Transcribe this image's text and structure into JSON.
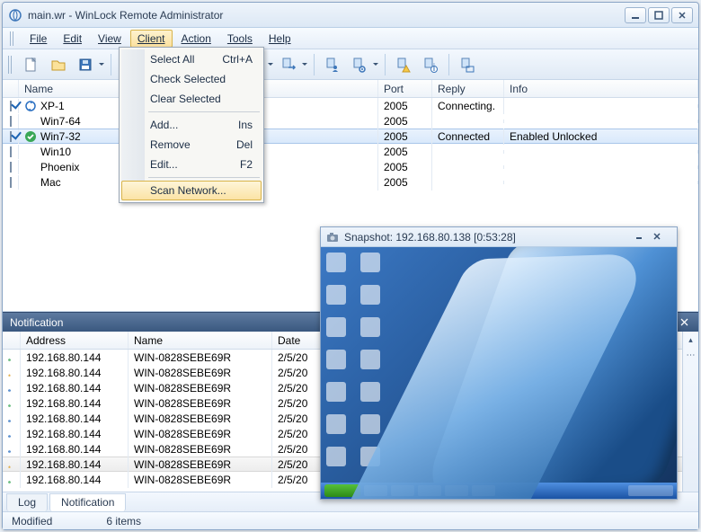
{
  "window": {
    "title": "main.wr - WinLock Remote Administrator"
  },
  "menu": [
    "File",
    "Edit",
    "View",
    "Client",
    "Action",
    "Tools",
    "Help"
  ],
  "client_menu": {
    "select_all": "Select All",
    "select_all_sc": "Ctrl+A",
    "check_selected": "Check Selected",
    "clear_selected": "Clear Selected",
    "add": "Add...",
    "add_sc": "Ins",
    "remove": "Remove",
    "remove_sc": "Del",
    "edit": "Edit...",
    "edit_sc": "F2",
    "scan": "Scan Network..."
  },
  "grid": {
    "cols": {
      "name": "Name",
      "port": "Port",
      "reply": "Reply",
      "info": "Info"
    },
    "rows": [
      {
        "checked": true,
        "status": "sync",
        "name": "XP-1",
        "port": "2005",
        "reply": "Connecting.",
        "info": "",
        "sel": false
      },
      {
        "checked": false,
        "status": "",
        "name": "Win7-64",
        "port": "2005",
        "reply": "",
        "info": "",
        "sel": false
      },
      {
        "checked": true,
        "status": "ok",
        "name": "Win7-32",
        "port": "2005",
        "reply": "Connected",
        "info": "Enabled Unlocked",
        "sel": true
      },
      {
        "checked": false,
        "status": "",
        "name": "Win10",
        "port": "2005",
        "reply": "",
        "info": "",
        "sel": false
      },
      {
        "checked": false,
        "status": "",
        "name": "Phoenix",
        "port": "2005",
        "reply": "",
        "info": "",
        "sel": false
      },
      {
        "checked": false,
        "status": "",
        "name": "Mac",
        "port": "2005",
        "reply": "",
        "info": "",
        "sel": false
      }
    ]
  },
  "notification": {
    "title": "Notification",
    "cols": {
      "address": "Address",
      "name": "Name",
      "date": "Date"
    },
    "rows": [
      {
        "icon": "ok",
        "addr": "192.168.80.144",
        "name": "WIN-0828SEBE69R",
        "date": "2/5/20",
        "sel": false
      },
      {
        "icon": "lock",
        "addr": "192.168.80.144",
        "name": "WIN-0828SEBE69R",
        "date": "2/5/20",
        "sel": false
      },
      {
        "icon": "info",
        "addr": "192.168.80.144",
        "name": "WIN-0828SEBE69R",
        "date": "2/5/20",
        "sel": false
      },
      {
        "icon": "ok",
        "addr": "192.168.80.144",
        "name": "WIN-0828SEBE69R",
        "date": "2/5/20",
        "sel": false
      },
      {
        "icon": "info",
        "addr": "192.168.80.144",
        "name": "WIN-0828SEBE69R",
        "date": "2/5/20",
        "sel": false
      },
      {
        "icon": "info",
        "addr": "192.168.80.144",
        "name": "WIN-0828SEBE69R",
        "date": "2/5/20",
        "sel": false
      },
      {
        "icon": "info",
        "addr": "192.168.80.144",
        "name": "WIN-0828SEBE69R",
        "date": "2/5/20",
        "sel": false
      },
      {
        "icon": "lock",
        "addr": "192.168.80.144",
        "name": "WIN-0828SEBE69R",
        "date": "2/5/20",
        "sel": true
      },
      {
        "icon": "ok",
        "addr": "192.168.80.144",
        "name": "WIN-0828SEBE69R",
        "date": "2/5/20",
        "sel": false
      }
    ]
  },
  "tabs": {
    "log": "Log",
    "notification": "Notification"
  },
  "status": {
    "left": "Modified",
    "right": "6 items"
  },
  "snapshot": {
    "title": "Snapshot: 192.168.80.138 [0:53:28]"
  }
}
